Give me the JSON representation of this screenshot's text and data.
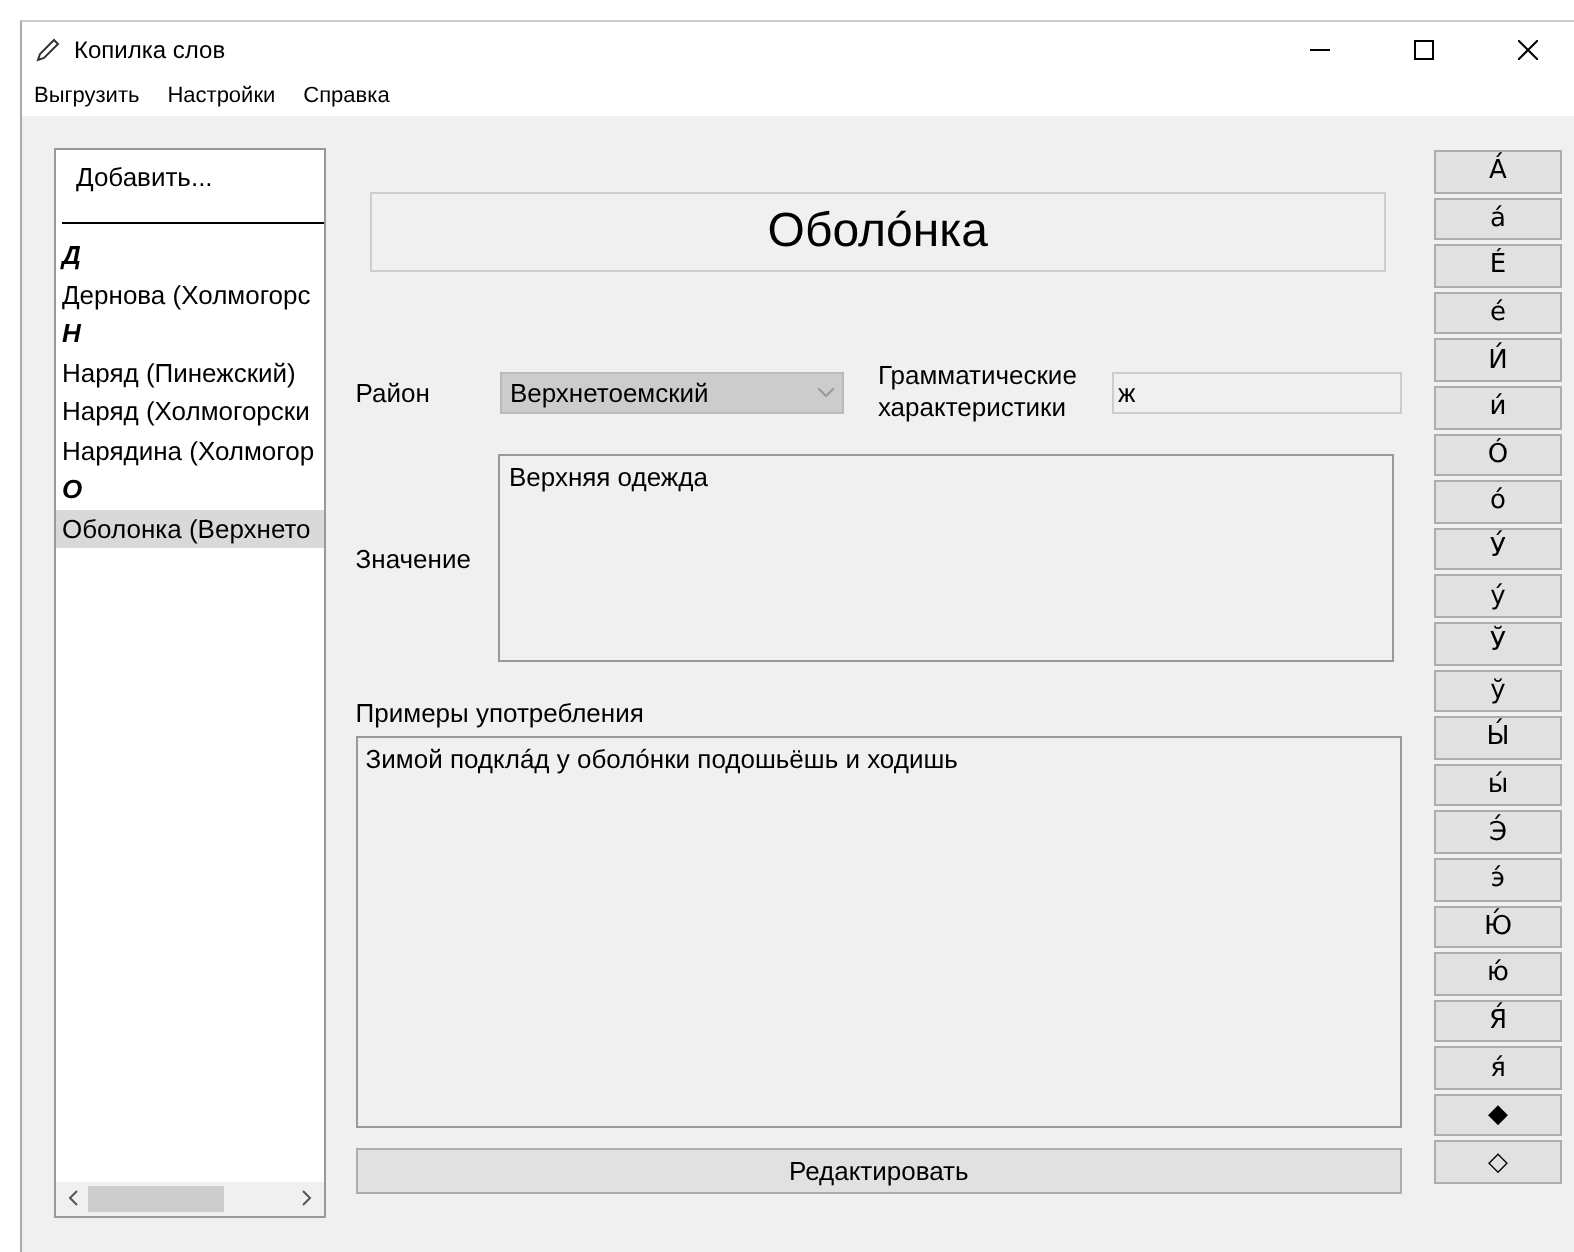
{
  "window": {
    "title": "Копилка слов"
  },
  "menu": [
    "Выгрузить",
    "Настройки",
    "Справка"
  ],
  "word_list": {
    "items": [
      {
        "kind": "action",
        "text": "Добавить..."
      },
      {
        "kind": "separator"
      },
      {
        "kind": "header",
        "text": "Д"
      },
      {
        "kind": "entry",
        "text": "Дернова (Холмогорс",
        "selected": false
      },
      {
        "kind": "header",
        "text": "Н"
      },
      {
        "kind": "entry",
        "text": "Наряд (Пинежский)",
        "selected": false
      },
      {
        "kind": "entry",
        "text": "Наряд (Холмогорски",
        "selected": false
      },
      {
        "kind": "entry",
        "text": "Нарядина (Холмогор",
        "selected": false
      },
      {
        "kind": "header",
        "text": "О"
      },
      {
        "kind": "entry",
        "text": "Оболонка (Верхнето",
        "selected": true
      }
    ]
  },
  "word": {
    "title": "Оболóнка"
  },
  "district": {
    "label": "Район",
    "value": "Верхнетоемский"
  },
  "grammar": {
    "label": "Грамматические характеристики",
    "value": "ж"
  },
  "meaning": {
    "label": "Значение",
    "value": "Верхняя одежда"
  },
  "examples": {
    "label": "Примеры употребления",
    "value": "Зимой подклáд у оболóнки подошьёшь и ходишь"
  },
  "edit_button": "Редактировать",
  "char_buttons": [
    "А́",
    "а́",
    "É",
    "é",
    "И́",
    "и́",
    "Ó",
    "ó",
    "У́",
    "у́",
    "Ў",
    "ў",
    "Ы́",
    "ы́",
    "Э́",
    "э́",
    "Ю́",
    "ю́",
    "Я́",
    "я́",
    "◆",
    "◇"
  ]
}
